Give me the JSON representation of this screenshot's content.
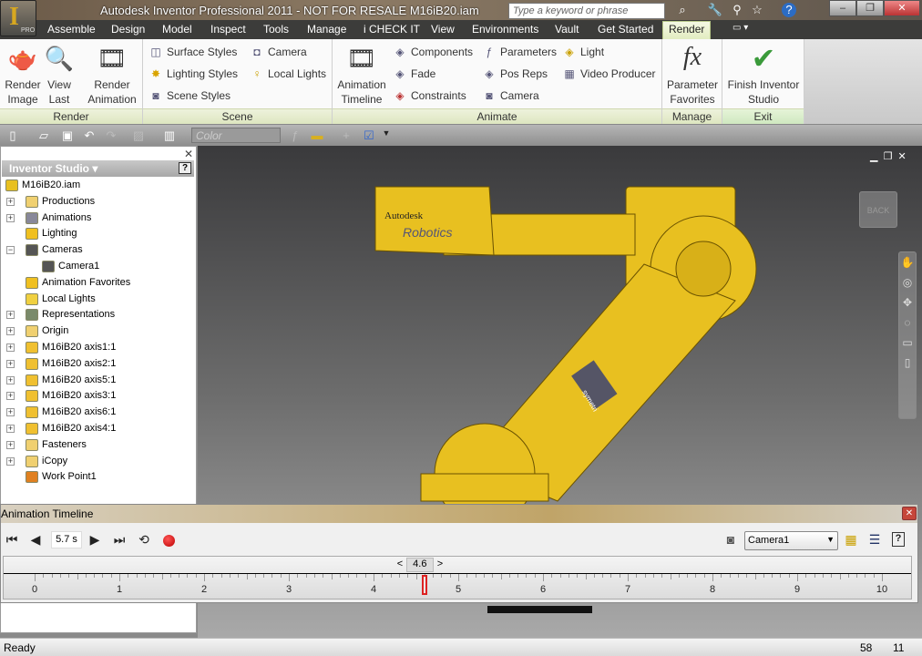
{
  "titlebar": {
    "title": "Autodesk Inventor Professional 2011 - NOT FOR RESALE    M16iB20.iam",
    "app_badge": "PRO",
    "search_placeholder": "Type a keyword or phrase"
  },
  "tabs": [
    "Assemble",
    "Design",
    "Model",
    "Inspect",
    "Tools",
    "Manage",
    "i CHECK IT",
    "View",
    "Environments",
    "Vault",
    "Get Started",
    "Render"
  ],
  "active_tab": "Render",
  "ribbon": {
    "render": {
      "label": "Render",
      "render_image": "Render Image",
      "view_last": "View Last",
      "render_animation": "Render Animation"
    },
    "scene": {
      "label": "Scene",
      "surface_styles": "Surface Styles",
      "lighting_styles": "Lighting Styles",
      "scene_styles": "Scene Styles",
      "camera": "Camera",
      "local_lights": "Local Lights"
    },
    "animate": {
      "label": "Animate",
      "animation_timeline": "Animation Timeline",
      "components": "Components",
      "fade": "Fade",
      "constraints": "Constraints",
      "parameters": "Parameters",
      "pos_reps": "Pos Reps",
      "camera": "Camera",
      "light": "Light",
      "video_producer": "Video Producer"
    },
    "manage": {
      "label": "Manage",
      "parameter_favorites": "Parameter Favorites"
    },
    "exit": {
      "label": "Exit",
      "finish": "Finish Inventor Studio"
    }
  },
  "qat": {
    "color_placeholder": "Color"
  },
  "browser": {
    "title": "Inventor Studio",
    "help": "?",
    "items": [
      {
        "label": "M16iB20.iam",
        "level": 0,
        "expand": "",
        "icon": "assembly"
      },
      {
        "label": "Productions",
        "level": 1,
        "expand": "+",
        "icon": "folder"
      },
      {
        "label": "Animations",
        "level": 1,
        "expand": "+",
        "icon": "animation"
      },
      {
        "label": "Lighting",
        "level": 1,
        "expand": "",
        "icon": "light"
      },
      {
        "label": "Cameras",
        "level": 1,
        "expand": "-",
        "icon": "camera"
      },
      {
        "label": "Camera1",
        "level": 2,
        "expand": "",
        "icon": "camera"
      },
      {
        "label": "Animation Favorites",
        "level": 1,
        "expand": "",
        "icon": "star"
      },
      {
        "label": "Local Lights",
        "level": 1,
        "expand": "",
        "icon": "bulb"
      },
      {
        "label": "Representations",
        "level": 1,
        "expand": "+",
        "icon": "rep"
      },
      {
        "label": "Origin",
        "level": 1,
        "expand": "+",
        "icon": "folder"
      },
      {
        "label": "M16iB20 axis1:1",
        "level": 1,
        "expand": "+",
        "icon": "part"
      },
      {
        "label": "M16iB20 axis2:1",
        "level": 1,
        "expand": "+",
        "icon": "part"
      },
      {
        "label": "M16iB20 axis5:1",
        "level": 1,
        "expand": "+",
        "icon": "part"
      },
      {
        "label": "M16iB20 axis3:1",
        "level": 1,
        "expand": "+",
        "icon": "part"
      },
      {
        "label": "M16iB20 axis6:1",
        "level": 1,
        "expand": "+",
        "icon": "part"
      },
      {
        "label": "M16iB20 axis4:1",
        "level": 1,
        "expand": "+",
        "icon": "part"
      },
      {
        "label": "Fasteners",
        "level": 1,
        "expand": "+",
        "icon": "folder"
      },
      {
        "label": "iCopy",
        "level": 1,
        "expand": "+",
        "icon": "folder"
      },
      {
        "label": "Work Point1",
        "level": 1,
        "expand": "",
        "icon": "point"
      }
    ]
  },
  "viewport": {
    "back_label": "BACK",
    "model_text1": "Autodesk",
    "model_text2": "Robotics",
    "model_text3": "symetri"
  },
  "timeline": {
    "title": "Animation Timeline",
    "time_field": "5.7 s",
    "camera": "Camera1",
    "current_time": "4.6",
    "current_value": 4.6,
    "ticks": [
      "0",
      "1",
      "2",
      "3",
      "4",
      "5",
      "6",
      "7",
      "8",
      "9",
      "10"
    ],
    "prev": "<",
    "next": ">"
  },
  "status": {
    "text": "Ready",
    "num1": "58",
    "num2": "11"
  }
}
